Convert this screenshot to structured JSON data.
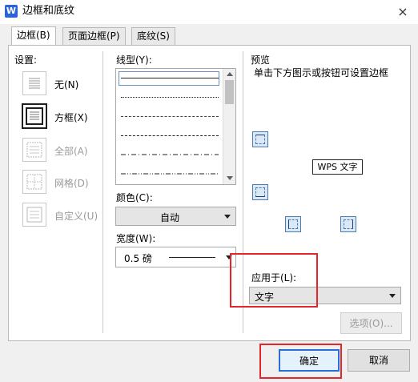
{
  "window": {
    "title": "边框和底纹",
    "app_icon": "W",
    "close_glyph": "×"
  },
  "tabs": [
    {
      "label": "边框(B)",
      "active": true
    },
    {
      "label": "页面边框(P)",
      "active": false
    },
    {
      "label": "底纹(S)",
      "active": false
    }
  ],
  "settings": {
    "heading": "设置:",
    "items": [
      {
        "label": "无(N)",
        "icon": "border-none-icon",
        "enabled": true,
        "selected": false
      },
      {
        "label": "方框(X)",
        "icon": "border-box-icon",
        "enabled": true,
        "selected": true
      },
      {
        "label": "全部(A)",
        "icon": "border-all-icon",
        "enabled": false,
        "selected": false
      },
      {
        "label": "网格(D)",
        "icon": "border-grid-icon",
        "enabled": false,
        "selected": false
      },
      {
        "label": "自定义(U)",
        "icon": "border-custom-icon",
        "enabled": false,
        "selected": false
      }
    ]
  },
  "line_style": {
    "heading": "线型(Y):",
    "styles": [
      "solid",
      "dotted",
      "dashed",
      "dash-dot",
      "dash-dot-dot"
    ]
  },
  "color": {
    "heading": "颜色(C):",
    "value": "自动"
  },
  "width": {
    "heading": "宽度(W):",
    "value": "0.5 磅"
  },
  "preview": {
    "heading": "预览",
    "hint": "单击下方图示或按钮可设置边框",
    "sample_text": "WPS 文字"
  },
  "apply_to": {
    "heading": "应用于(L):",
    "value": "文字"
  },
  "buttons": {
    "options": "选项(O)...",
    "ok": "确定",
    "cancel": "取消"
  },
  "colors": {
    "highlight": "#e3262c",
    "accent": "#4b7ab5"
  }
}
